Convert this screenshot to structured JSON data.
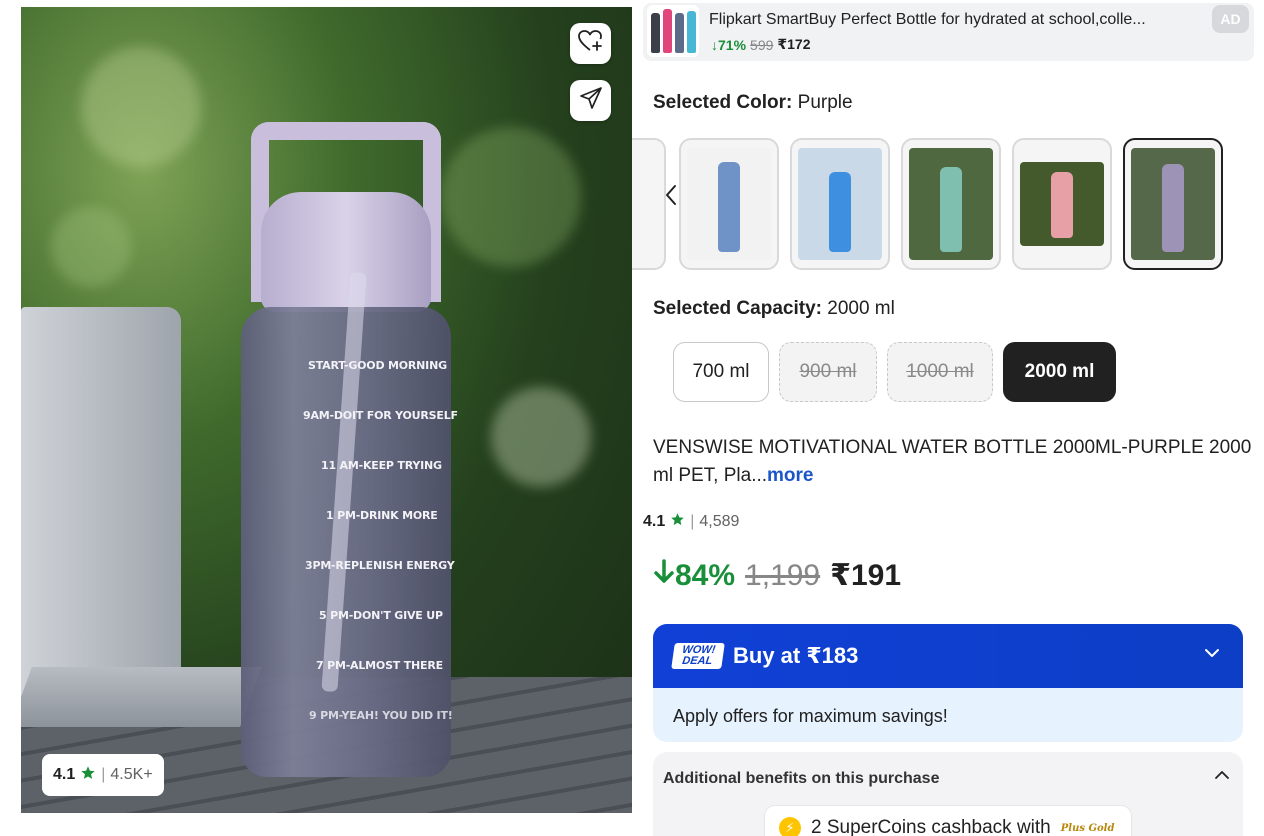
{
  "hero": {
    "bottle_marks": [
      "START-GOOD MORNING",
      "9AM-DOIT FOR YOURSELF",
      "11 AM-KEEP TRYING",
      "1 PM-DRINK MORE",
      "3PM-REPLENISH ENERGY",
      "5 PM-DON'T GIVE UP",
      "7 PM-ALMOST THERE",
      "9 PM-YEAH! YOU DID IT!"
    ],
    "rating": "4.1",
    "rating_sep": "|",
    "rating_count": "4.5K+",
    "wishlist_icon": "heart-plus-icon",
    "share_icon": "share-icon"
  },
  "ad": {
    "title": "Flipkart SmartBuy Perfect Bottle for hydrated at school,colle...",
    "discount": "↓71%",
    "original_price": "599",
    "price": "₹172",
    "badge": "AD"
  },
  "color": {
    "label": "Selected Color:",
    "value": "Purple",
    "swatches": [
      {
        "name": "blue",
        "bottle": "#6f93c7",
        "bg": "#f2f2f2"
      },
      {
        "name": "blue-desk",
        "bottle": "#3f8fe0",
        "bg": "#c9d9e8"
      },
      {
        "name": "green",
        "bottle": "#7fbfb0",
        "bg": "#50683f"
      },
      {
        "name": "pink",
        "bottle": "#e6a0a6",
        "bg": "#445a2c"
      },
      {
        "name": "purple",
        "bottle": "#9c93b6",
        "bg": "#56684a"
      }
    ]
  },
  "capacity": {
    "label": "Selected Capacity:",
    "value": "2000 ml",
    "options": [
      "700 ml",
      "900 ml",
      "1000 ml",
      "2000 ml"
    ]
  },
  "product": {
    "title": "VENSWISE MOTIVATIONAL WATER BOTTLE 2000ML-PURPLE 2000 ml PET, Pla...",
    "more": "more",
    "rating": "4.1",
    "rating_sep": "|",
    "rating_count": "4,589",
    "discount": "84%",
    "original_price": "1,199",
    "price": "₹191"
  },
  "wow_deal": {
    "logo_line1": "WOW!",
    "logo_line2": "DEAL",
    "buy_label": "Buy at ₹183",
    "offer_text": "Apply offers for maximum savings!"
  },
  "benefits": {
    "heading": "Additional benefits on this purchase",
    "supercoins": "2 SuperCoins cashback with",
    "plus_gold": "Plus Gold"
  },
  "colors": {
    "green": "#1a8f3a",
    "blue_link": "#1a55c9",
    "wow_blue": "#0c3ec6"
  }
}
